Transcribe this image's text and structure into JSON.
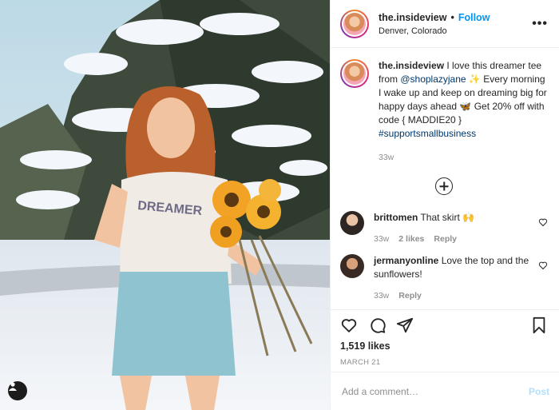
{
  "post": {
    "username": "the.insideview",
    "follow_label": "Follow",
    "separator": "•",
    "location": "Denver, Colorado",
    "more_label": "•••"
  },
  "caption": {
    "username": "the.insideview",
    "text_1": " I love this dreamer tee from ",
    "mention": "@shoplazyjane",
    "emoji_1": "✨",
    "text_2": " Every morning I wake up and keep on dreaming big for happy days ahead ",
    "emoji_2": "🦋",
    "text_3": " Get 20% off with code { MADDIE20 } ",
    "hashtag": "#supportsmallbusiness",
    "time": "33w"
  },
  "comments": [
    {
      "username": "brittomen",
      "text": " That skirt ",
      "emoji": "🙌",
      "time": "33w",
      "likes": "2 likes",
      "reply": "Reply"
    },
    {
      "username": "jermanyonline",
      "text": " Love the top and the sunflowers!",
      "time": "33w",
      "reply": "Reply"
    }
  ],
  "stats": {
    "likes": "1,519 likes",
    "date": "MARCH 21"
  },
  "add_comment": {
    "placeholder": "Add a comment…",
    "post_label": "Post"
  },
  "colors": {
    "link": "#00376b",
    "follow": "#0095f6",
    "post_disabled": "#b2dffc"
  }
}
